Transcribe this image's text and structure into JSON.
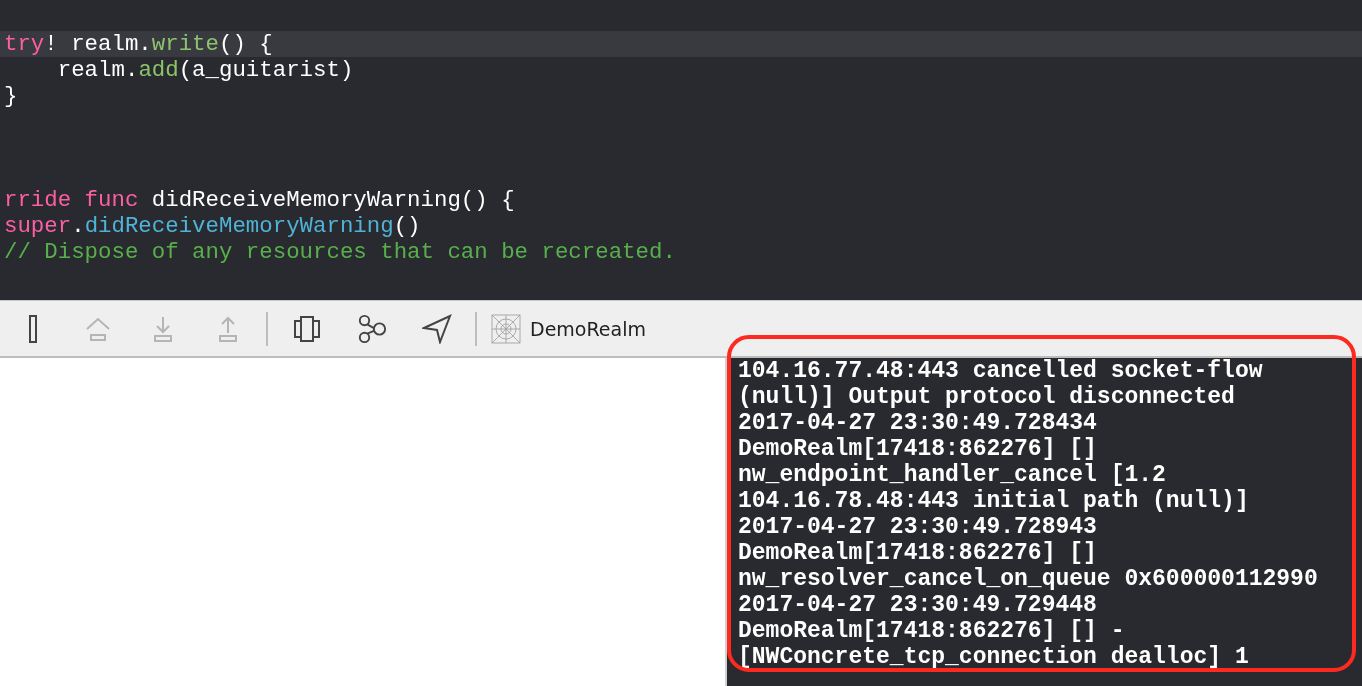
{
  "editor": {
    "blocks": [
      {
        "lines": [
          {
            "highlighted": true,
            "tokens": [
              {
                "kind": "keyword",
                "text": "try"
              },
              {
                "kind": "plain",
                "text": "! realm."
              },
              {
                "kind": "method",
                "text": "write"
              },
              {
                "kind": "plain",
                "text": "() {"
              }
            ]
          },
          {
            "highlighted": false,
            "tokens": [
              {
                "kind": "plain",
                "text": "    realm."
              },
              {
                "kind": "method",
                "text": "add"
              },
              {
                "kind": "plain",
                "text": "(a_guitarist)"
              }
            ]
          },
          {
            "highlighted": false,
            "tokens": [
              {
                "kind": "plain",
                "text": "}"
              }
            ]
          }
        ]
      },
      {
        "lines": [
          {
            "highlighted": false,
            "tokens": [
              {
                "kind": "keyword",
                "text": "rride func"
              },
              {
                "kind": "plain",
                "text": " didReceiveMemoryWarning() {"
              }
            ]
          },
          {
            "highlighted": false,
            "tokens": [
              {
                "kind": "keyword",
                "text": "super"
              },
              {
                "kind": "plain",
                "text": "."
              },
              {
                "kind": "system",
                "text": "didReceiveMemoryWarning"
              },
              {
                "kind": "plain",
                "text": "()"
              }
            ]
          },
          {
            "highlighted": false,
            "tokens": [
              {
                "kind": "comment",
                "text": "// Dispose of any resources that can be recreated."
              }
            ]
          }
        ]
      }
    ]
  },
  "toolbar": {
    "buttons": [
      {
        "kind": "panel",
        "disabled": false
      },
      {
        "kind": "step-over",
        "disabled": true
      },
      {
        "kind": "step-in",
        "disabled": true
      },
      {
        "kind": "step-out",
        "disabled": true
      },
      {
        "kind": "separator"
      },
      {
        "kind": "view-debugger",
        "disabled": false
      },
      {
        "kind": "memory-graph",
        "disabled": false
      },
      {
        "kind": "location",
        "disabled": false
      },
      {
        "kind": "separator"
      }
    ],
    "scheme": "DemoRealm"
  },
  "console": {
    "lines": [
      "104.16.77.48:443 cancelled socket-flow",
      "(null)] Output protocol disconnected",
      "2017-04-27 23:30:49.728434",
      "DemoRealm[17418:862276] []",
      "nw_endpoint_handler_cancel [1.2",
      "104.16.78.48:443 initial path (null)]",
      "2017-04-27 23:30:49.728943",
      "DemoRealm[17418:862276] []",
      "nw_resolver_cancel_on_queue 0x600000112990",
      "2017-04-27 23:30:49.729448",
      "DemoRealm[17418:862276] [] -",
      "[NWConcrete_tcp_connection dealloc] 1"
    ]
  }
}
